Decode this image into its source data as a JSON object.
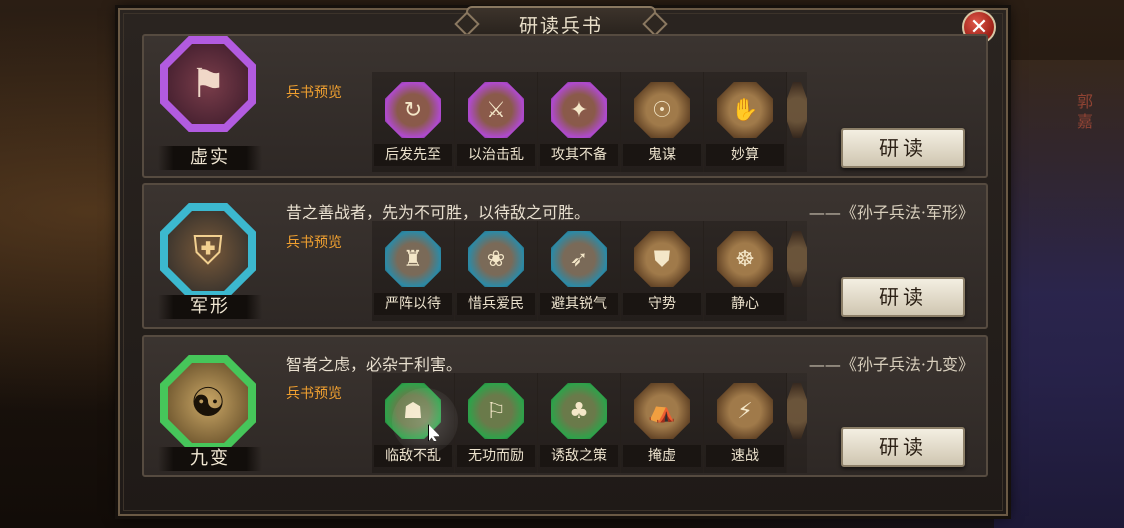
{
  "window": {
    "title": "研读兵书",
    "close_icon": "✕"
  },
  "background": {
    "side_text": "郭嘉"
  },
  "common": {
    "preview_label": "兵书预览",
    "read_button": "研读"
  },
  "sections": [
    {
      "name": "虚实",
      "quote": "",
      "source": "",
      "emblem_icon": "banner-icon",
      "emblem_glyph": "⚑",
      "frame": "purple",
      "skills": [
        {
          "name": "后发先至",
          "icon": "↻",
          "frame": "purple"
        },
        {
          "name": "以治击乱",
          "icon": "⚔",
          "frame": "purple"
        },
        {
          "name": "攻其不备",
          "icon": "✦",
          "frame": "purple"
        },
        {
          "name": "鬼谋",
          "icon": "☉",
          "frame": "gold"
        },
        {
          "name": "妙算",
          "icon": "✋",
          "frame": "gold"
        }
      ]
    },
    {
      "name": "军形",
      "quote": "昔之善战者，先为不可胜，以待敌之可胜。",
      "source": "——《孙子兵法·军形》",
      "emblem_icon": "shield-spear-icon",
      "emblem_glyph": "⛨",
      "frame": "blue",
      "skills": [
        {
          "name": "严阵以待",
          "icon": "♜",
          "frame": "blue"
        },
        {
          "name": "惜兵爱民",
          "icon": "❀",
          "frame": "blue"
        },
        {
          "name": "避其锐气",
          "icon": "➶",
          "frame": "blue"
        },
        {
          "name": "守势",
          "icon": "⛊",
          "frame": "gold"
        },
        {
          "name": "静心",
          "icon": "☸",
          "frame": "gold"
        }
      ]
    },
    {
      "name": "九变",
      "quote": "智者之虑，必杂于利害。",
      "source": "——《孙子兵法·九变》",
      "emblem_icon": "yin-yang-icon",
      "emblem_glyph": "☯",
      "frame": "green",
      "skills": [
        {
          "name": "临敌不乱",
          "icon": "☗",
          "frame": "green"
        },
        {
          "name": "无功而励",
          "icon": "⚐",
          "frame": "green"
        },
        {
          "name": "诱敌之策",
          "icon": "♣",
          "frame": "green"
        },
        {
          "name": "掩虚",
          "icon": "⛺",
          "frame": "gold"
        },
        {
          "name": "速战",
          "icon": "⚡",
          "frame": "gold"
        }
      ]
    }
  ]
}
